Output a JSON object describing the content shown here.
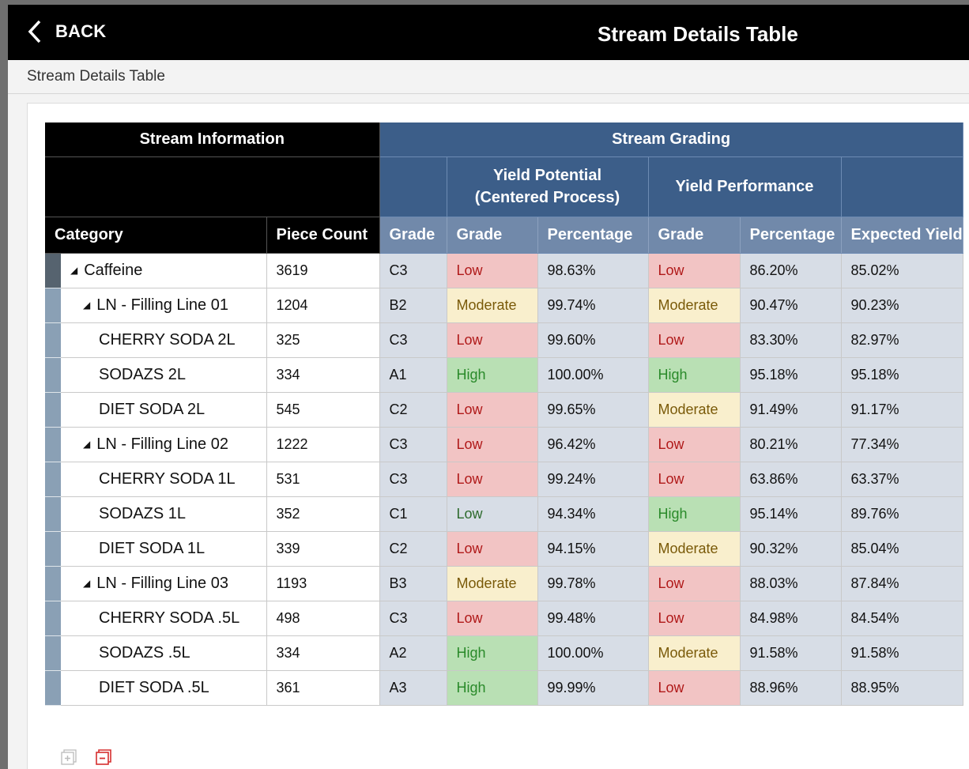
{
  "header": {
    "back_label": "BACK",
    "title": "Stream Details Table"
  },
  "breadcrumb": "Stream Details Table",
  "table": {
    "group_headers": {
      "stream_information": "Stream Information",
      "stream_grading": "Stream Grading"
    },
    "sub_headers": {
      "yield_potential": "Yield Potential",
      "yield_potential_sub": "(Centered Process)",
      "yield_performance": "Yield Performance"
    },
    "columns": [
      "Category",
      "Piece Count",
      "Grade",
      "Grade",
      "Percentage",
      "Grade",
      "Percentage",
      "Expected Yield"
    ],
    "rows": [
      {
        "category": "Caffeine",
        "level": 0,
        "expandable": true,
        "piece_count": "3619",
        "grade": "C3",
        "yp_grade": "Low",
        "yp_pct": "98.63%",
        "yperf_grade": "Low",
        "yperf_pct": "86.20%",
        "expected": "85.02%"
      },
      {
        "category": "LN - Filling Line 01",
        "level": 1,
        "expandable": true,
        "piece_count": "1204",
        "grade": "B2",
        "yp_grade": "Moderate",
        "yp_pct": "99.74%",
        "yperf_grade": "Moderate",
        "yperf_pct": "90.47%",
        "expected": "90.23%"
      },
      {
        "category": "CHERRY SODA 2L",
        "level": 2,
        "piece_count": "325",
        "grade": "C3",
        "yp_grade": "Low",
        "yp_pct": "99.60%",
        "yperf_grade": "Low",
        "yperf_pct": "83.30%",
        "expected": "82.97%"
      },
      {
        "category": "SODAZS 2L",
        "level": 2,
        "piece_count": "334",
        "grade": "A1",
        "yp_grade": "High",
        "yp_pct": "100.00%",
        "yperf_grade": "High",
        "yperf_pct": "95.18%",
        "expected": "95.18%"
      },
      {
        "category": "DIET SODA 2L",
        "level": 2,
        "piece_count": "545",
        "grade": "C2",
        "yp_grade": "Low",
        "yp_pct": "99.65%",
        "yperf_grade": "Moderate",
        "yperf_pct": "91.49%",
        "expected": "91.17%"
      },
      {
        "category": "LN - Filling Line 02",
        "level": 1,
        "expandable": true,
        "piece_count": "1222",
        "grade": "C3",
        "yp_grade": "Low",
        "yp_pct": "96.42%",
        "yperf_grade": "Low",
        "yperf_pct": "80.21%",
        "expected": "77.34%"
      },
      {
        "category": "CHERRY SODA 1L",
        "level": 2,
        "piece_count": "531",
        "grade": "C3",
        "yp_grade": "Low",
        "yp_pct": "99.24%",
        "yperf_grade": "Low",
        "yperf_pct": "63.86%",
        "expected": "63.37%"
      },
      {
        "category": "SODAZS 1L",
        "level": 2,
        "piece_count": "352",
        "grade": "C1",
        "yp_grade": "Low",
        "yp_pct": "94.34%",
        "yperf_grade": "High",
        "yperf_pct": "95.14%",
        "expected": "89.76%"
      },
      {
        "category": "DIET SODA 1L",
        "level": 2,
        "piece_count": "339",
        "grade": "C2",
        "yp_grade": "Low",
        "yp_pct": "94.15%",
        "yperf_grade": "Moderate",
        "yperf_pct": "90.32%",
        "expected": "85.04%"
      },
      {
        "category": "LN - Filling Line 03",
        "level": 1,
        "expandable": true,
        "piece_count": "1193",
        "grade": "B3",
        "yp_grade": "Moderate",
        "yp_pct": "99.78%",
        "yperf_grade": "Low",
        "yperf_pct": "88.03%",
        "expected": "87.84%"
      },
      {
        "category": "CHERRY SODA .5L",
        "level": 2,
        "piece_count": "498",
        "grade": "C3",
        "yp_grade": "Low",
        "yp_pct": "99.48%",
        "yperf_grade": "Low",
        "yperf_pct": "84.98%",
        "expected": "84.54%"
      },
      {
        "category": "SODAZS .5L",
        "level": 2,
        "piece_count": "334",
        "grade": "A2",
        "yp_grade": "High",
        "yp_pct": "100.00%",
        "yperf_grade": "Moderate",
        "yperf_pct": "91.58%",
        "expected": "91.58%"
      },
      {
        "category": "DIET SODA .5L",
        "level": 2,
        "piece_count": "361",
        "grade": "A3",
        "yp_grade": "High",
        "yp_pct": "99.99%",
        "yperf_grade": "Low",
        "yperf_pct": "88.96%",
        "expected": "88.95%"
      }
    ]
  },
  "footer": {
    "expand_all_icon": "expand-all-icon",
    "collapse_all_icon": "collapse-all-icon"
  },
  "colors": {
    "low_bg": "#f2c4c4",
    "moderate_bg": "#f9efcd",
    "high_bg": "#b9e0b4",
    "header_blue": "#3c5e89"
  }
}
